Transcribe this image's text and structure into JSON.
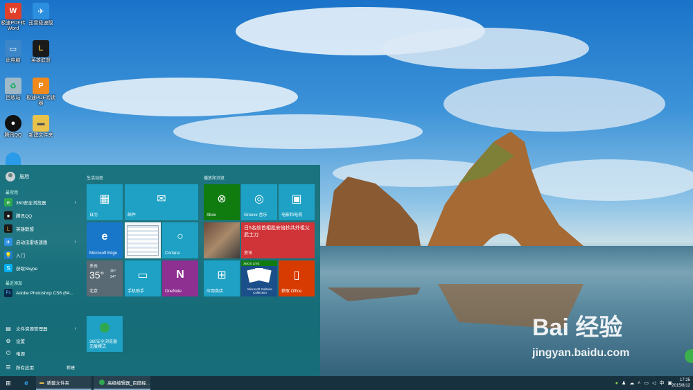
{
  "desktop": {
    "icons": [
      {
        "label": "极速PDF转Word",
        "icon": "pdf-word-icon",
        "color": "#e0402a"
      },
      {
        "label": "迅雷极速版",
        "icon": "thunder-icon",
        "color": "#2d8fe0"
      },
      {
        "label": "此电脑",
        "icon": "computer-icon",
        "color": "#3a86c8"
      },
      {
        "label": "英雄联盟",
        "icon": "lol-icon",
        "color": "#b08a2a"
      },
      {
        "label": "回收站",
        "icon": "recycle-bin-icon",
        "color": "#9fb9c8"
      },
      {
        "label": "极速PDF阅读器",
        "icon": "pdf-reader-icon",
        "color": "#f08a1c"
      },
      {
        "label": "腾讯QQ",
        "icon": "qq-icon",
        "color": "#111"
      },
      {
        "label": "新建文件夹",
        "icon": "folder-icon",
        "color": "#e8c24a"
      }
    ]
  },
  "start_menu": {
    "user_name": "施旭",
    "most_used_label": "最常用",
    "most_used": [
      {
        "label": "360安全浏览器",
        "icon": "browser-360-icon",
        "color": "#2fa84f",
        "arrow": "›"
      },
      {
        "label": "腾讯QQ",
        "icon": "qq-icon",
        "color": "#1b1b1b",
        "arrow": ""
      },
      {
        "label": "英雄联盟",
        "icon": "lol-icon",
        "color": "#b08a2a",
        "arrow": ""
      },
      {
        "label": "启动迅雷极速版",
        "icon": "thunder-icon",
        "color": "#2d8fe0",
        "arrow": "›"
      },
      {
        "label": "入门",
        "icon": "lightbulb-icon",
        "color": "#1e7ec8",
        "arrow": ""
      },
      {
        "label": "获取Skype",
        "icon": "skype-icon",
        "color": "#00aff0",
        "arrow": ""
      }
    ],
    "recent_label": "最近添加",
    "recent": [
      {
        "label": "Adobe Photoshop CS6 (64...",
        "icon": "photoshop-icon",
        "color": "#0a2a4a"
      }
    ],
    "bottom": [
      {
        "label": "文件资源管理器",
        "icon": "file-explorer-icon",
        "arrow": "›"
      },
      {
        "label": "设置",
        "icon": "gear-icon",
        "arrow": ""
      },
      {
        "label": "电源",
        "icon": "power-icon",
        "arrow": ""
      },
      {
        "label": "所有应用",
        "icon": "all-apps-icon",
        "arrow": ""
      }
    ],
    "new_badge": "新建",
    "group1_title": "生活动态",
    "group2_title": "播放和浏览",
    "tiles": {
      "calendar": "日历",
      "mail": "邮件",
      "edge": "Microsoft Edge",
      "cortana": "Cortana",
      "weather_condition": "多云",
      "weather_temp": "35°",
      "weather_high": "35°",
      "weather_low": "24°",
      "weather_city": "北京",
      "phone_assistant": "手机助手",
      "onenote": "OneNote",
      "browser360": "360安全浏览器\n无痕模式",
      "xbox": "Xbox",
      "groove": "Groove 音乐",
      "movies": "电影和电视",
      "news_headline": "日5名前首相批安倍抄共外祖父武士刀",
      "news_label": "资讯",
      "store": "应用商店",
      "solitaire_badge": "XBOX LIVE",
      "solitaire": "Microsoft Solitaire Collection",
      "office": "获取 Office"
    }
  },
  "taskbar": {
    "items": [
      {
        "label": "新建文件夹",
        "icon": "folder-icon"
      },
      {
        "label": "高级编辑器_百度经...",
        "icon": "browser-360-icon"
      }
    ],
    "time": "17:25",
    "date": "2015/8/12"
  },
  "watermark": {
    "brand": "Bai  经验",
    "url": "jingyan.baidu.com"
  },
  "colors": {
    "start_bg": "#146e78",
    "tile_blue": "#1ea1c4",
    "tile_green": "#107c10",
    "tile_red": "#d13438",
    "tile_purple": "#8e2f92",
    "tile_orange": "#d83b01"
  }
}
